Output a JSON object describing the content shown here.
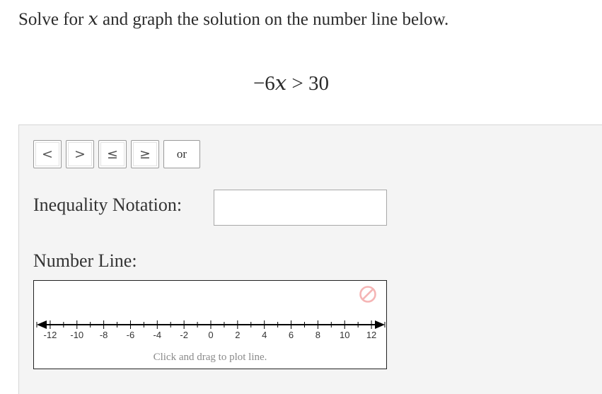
{
  "prompt": {
    "before": "Solve for ",
    "variable": "x",
    "after": " and graph the solution on the number line below."
  },
  "equation": {
    "coef": "−6",
    "variable": "x",
    "operator": " > ",
    "rhs": "30"
  },
  "buttons": [
    {
      "name": "less-than-button",
      "label": "<"
    },
    {
      "name": "greater-than-button",
      "label": ">"
    },
    {
      "name": "less-equal-button",
      "label": "≤"
    },
    {
      "name": "greater-equal-button",
      "label": "≥"
    },
    {
      "name": "or-button",
      "label": "or"
    }
  ],
  "inequality": {
    "label": "Inequality Notation:",
    "value": ""
  },
  "number_line": {
    "label": "Number Line:",
    "min": -13,
    "max": 13,
    "tick_labels": [
      "-12",
      "-10",
      "-8",
      "-6",
      "-4",
      "-2",
      "0",
      "2",
      "4",
      "6",
      "8",
      "10",
      "12"
    ],
    "hint": "Click and drag to plot line.",
    "clear_icon": "ban-icon",
    "clear_color": "#f5b5b5"
  }
}
